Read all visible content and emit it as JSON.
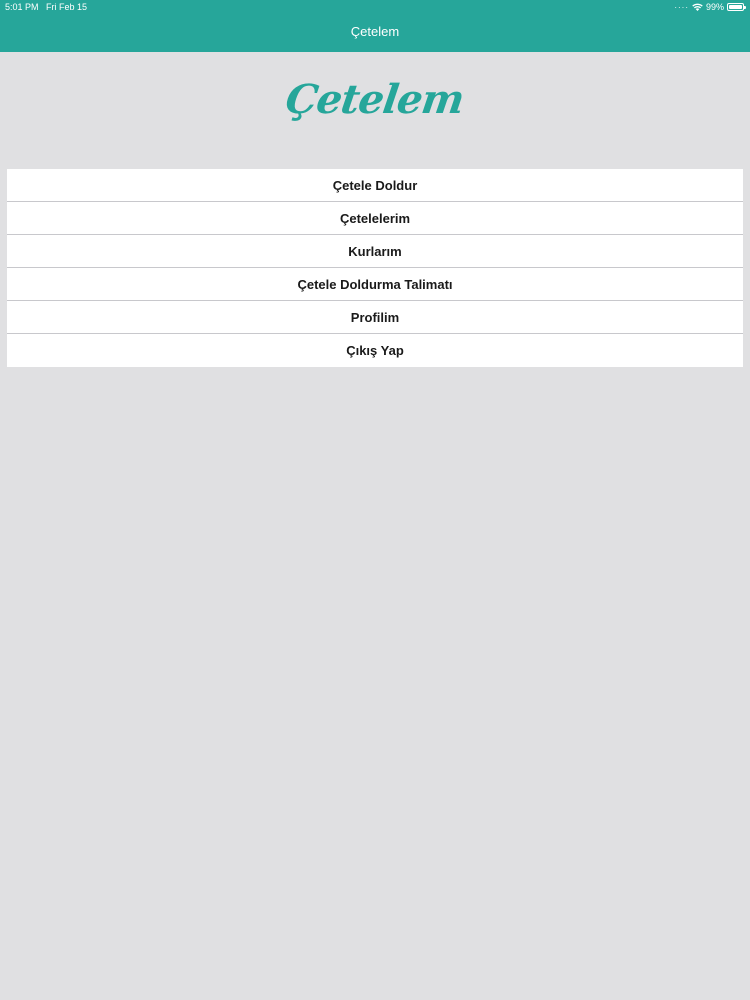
{
  "status_bar": {
    "time": "5:01 PM",
    "date": "Fri Feb 15",
    "battery": "99%",
    "icons": [
      "wifi-icon",
      "battery-icon"
    ]
  },
  "nav": {
    "title": "Çetelem"
  },
  "logo": {
    "text": "Çetelem"
  },
  "menu": {
    "items": [
      {
        "label": "Çetele Doldur"
      },
      {
        "label": "Çetelelerim"
      },
      {
        "label": "Kurlarım"
      },
      {
        "label": "Çetele Doldurma Talimatı"
      },
      {
        "label": "Profilim"
      },
      {
        "label": "Çıkış Yap"
      }
    ]
  },
  "colors": {
    "accent": "#26a69a",
    "background": "#e0e0e2",
    "row": "#ffffff"
  }
}
